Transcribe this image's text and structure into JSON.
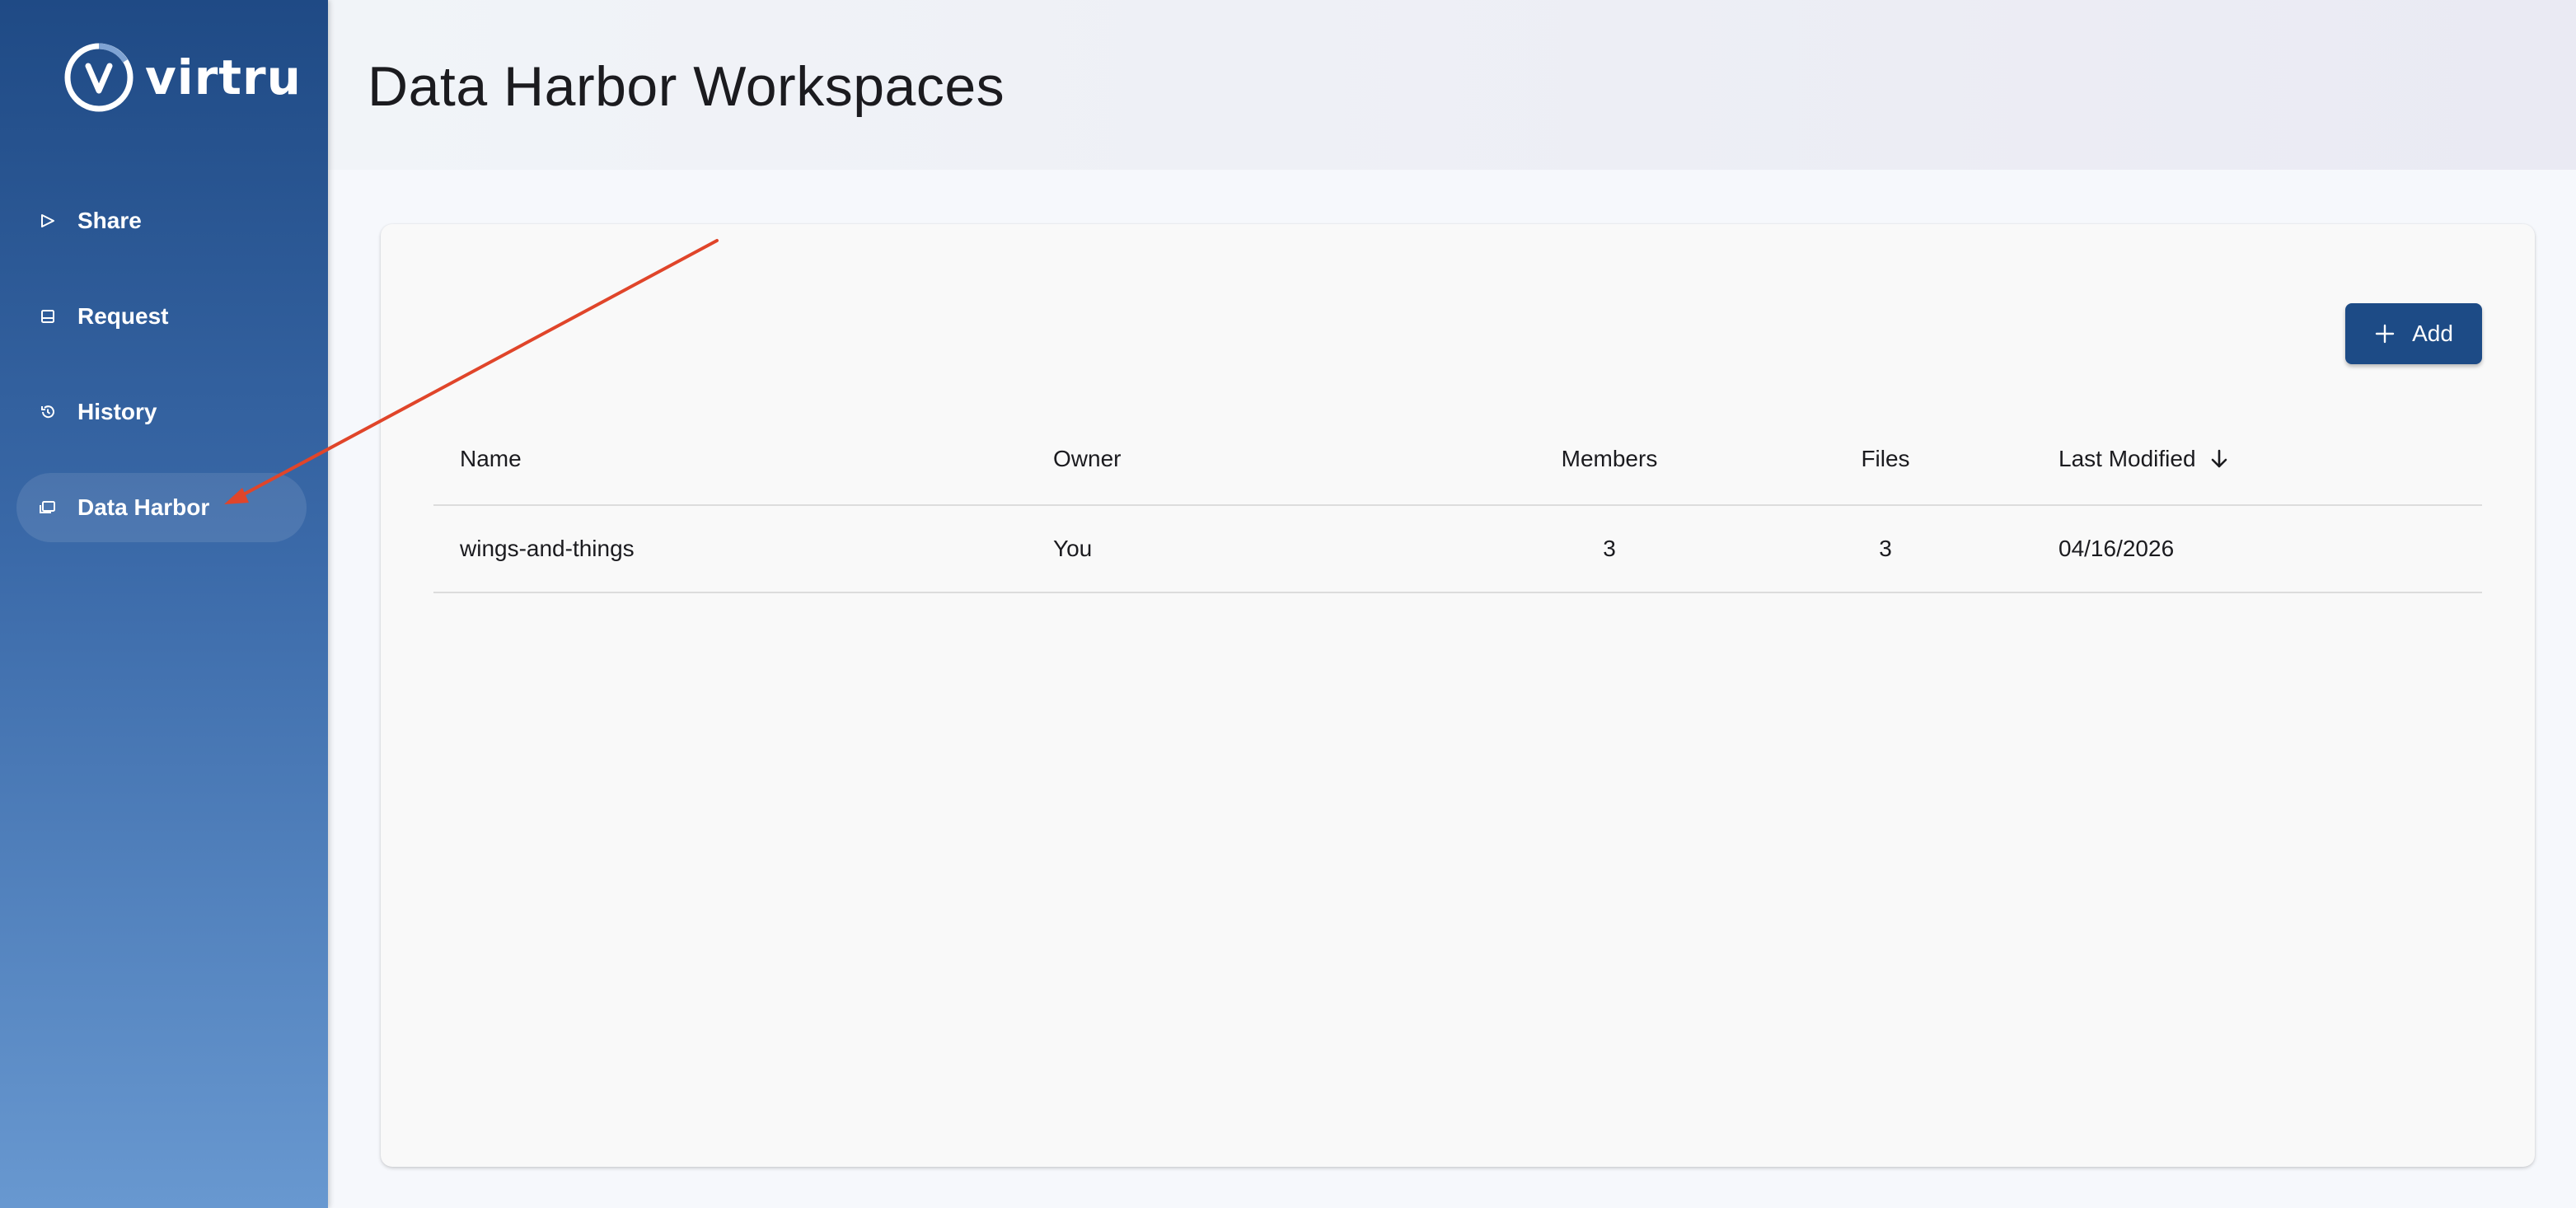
{
  "brand": {
    "name": "virtru"
  },
  "sidebar": {
    "items": [
      {
        "label": "Share",
        "icon": "send-icon"
      },
      {
        "label": "Request",
        "icon": "inbox-icon"
      },
      {
        "label": "History",
        "icon": "history-icon"
      },
      {
        "label": "Data Harbor",
        "icon": "folders-icon",
        "active": true
      }
    ]
  },
  "header": {
    "title": "Data Harbor Workspaces"
  },
  "toolbar": {
    "add_label": "Add"
  },
  "table": {
    "columns": [
      "Name",
      "Owner",
      "Members",
      "Files",
      "Last Modified"
    ],
    "sort": {
      "column": "Last Modified",
      "direction": "descending"
    },
    "rows": [
      {
        "name": "wings-and-things",
        "owner": "You",
        "members": "3",
        "files": "3",
        "last_modified": "04/16/2026"
      }
    ]
  },
  "colors": {
    "sidebar_top": "#1f4a85",
    "sidebar_bottom": "#6898d0",
    "accent_button": "#1d4b86",
    "annotation_arrow": "#e0452a"
  }
}
